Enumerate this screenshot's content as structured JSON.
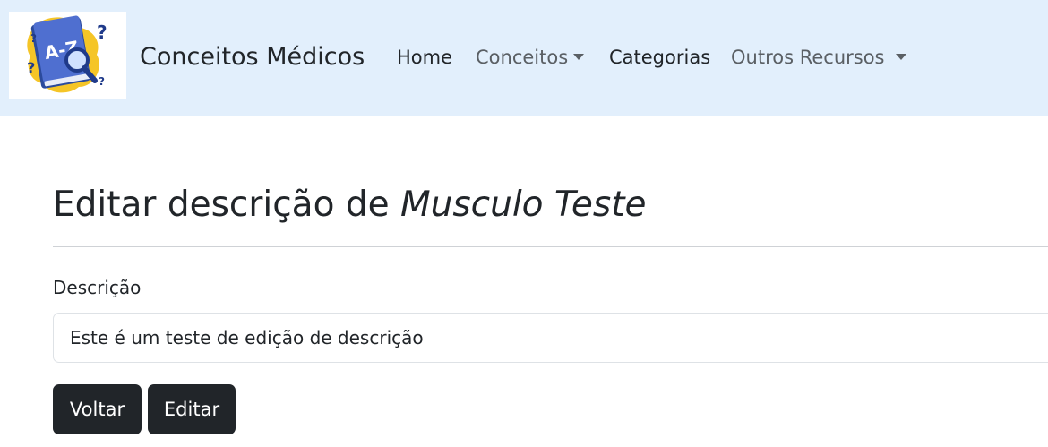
{
  "navbar": {
    "logo_icon": "a-z-book-magnifier-logo",
    "brand": "Conceitos Médicos",
    "items": [
      {
        "label": "Home",
        "dropdown": false
      },
      {
        "label": "Conceitos",
        "dropdown": true
      },
      {
        "label": "Categorias",
        "dropdown": false
      },
      {
        "label": "Outros Recursos",
        "dropdown": true
      }
    ],
    "background": "#e2effc"
  },
  "main": {
    "title_prefix": "Editar descrição de ",
    "title_term": "Musculo Teste",
    "field_label": "Descrição",
    "field_value": "Este é um teste de edição de descrição",
    "buttons": {
      "back": "Voltar",
      "edit": "Editar"
    },
    "button_color": "#212529"
  }
}
